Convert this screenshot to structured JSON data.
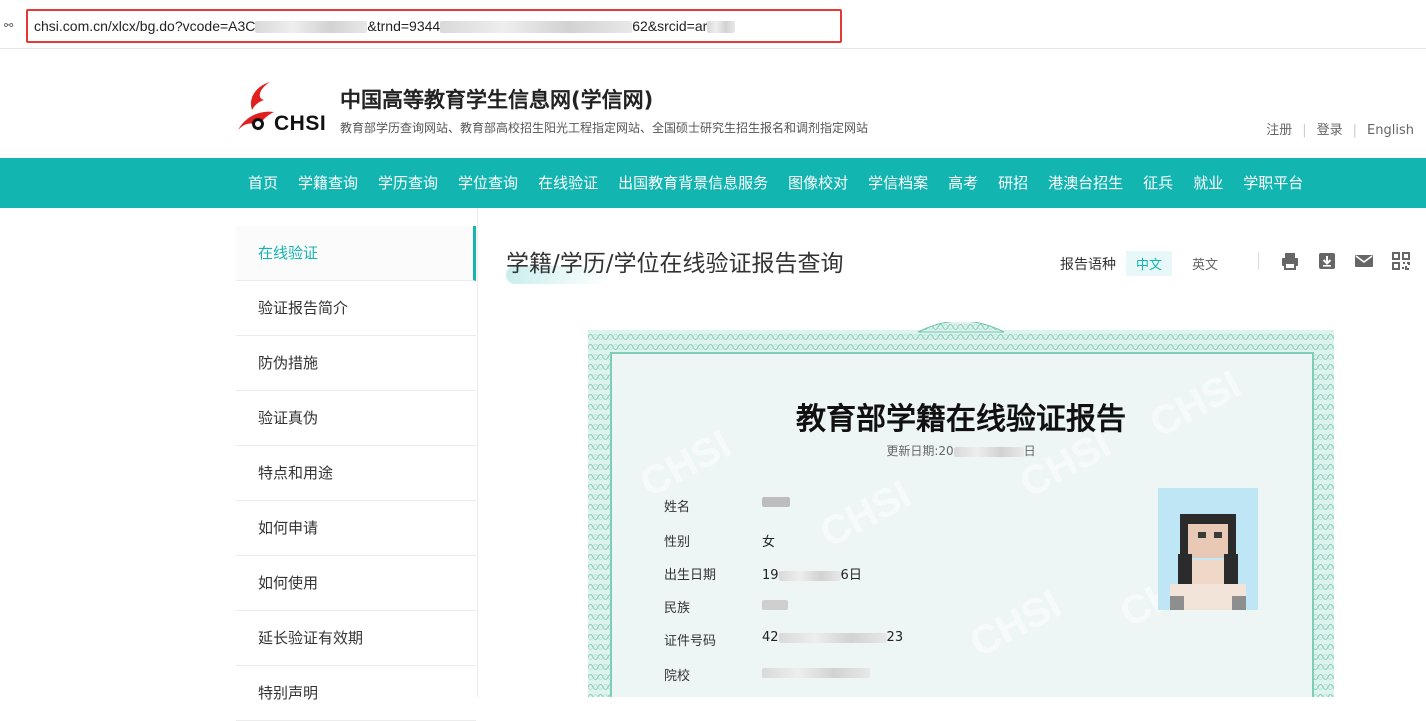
{
  "browser": {
    "url_parts": [
      "chsi.com.cn/xlcx/bg.do?vcode=A3C",
      "&trnd=9344",
      "62&srcid=ar"
    ]
  },
  "header": {
    "logo_text": "CHSI",
    "site_title": "中国高等教育学生信息网(学信网)",
    "site_subtitle": "教育部学历查询网站、教育部高校招生阳光工程指定网站、全国硕士研究生招生报名和调剂指定网站",
    "links": [
      "注册",
      "登录",
      "English"
    ]
  },
  "nav": {
    "items": [
      "首页",
      "学籍查询",
      "学历查询",
      "学位查询",
      "在线验证",
      "出国教育背景信息服务",
      "图像校对",
      "学信档案",
      "高考",
      "研招",
      "港澳台招生",
      "征兵",
      "就业",
      "学职平台"
    ]
  },
  "sidebar": {
    "items": [
      {
        "label": "在线验证",
        "active": true
      },
      {
        "label": "验证报告简介"
      },
      {
        "label": "防伪措施"
      },
      {
        "label": "验证真伪"
      },
      {
        "label": "特点和用途"
      },
      {
        "label": "如何申请"
      },
      {
        "label": "如何使用"
      },
      {
        "label": "延长验证有效期"
      },
      {
        "label": "特别声明"
      }
    ]
  },
  "main": {
    "title": "学籍/学历/学位在线验证报告查询",
    "lang_label": "报告语种",
    "lang_options": [
      "中文",
      "英文"
    ],
    "tool_icons": [
      "print-icon",
      "download-icon",
      "mail-icon",
      "qrcode-icon"
    ]
  },
  "certificate": {
    "title": "教育部学籍在线验证报告",
    "update_label": "更新日期:20",
    "update_suffix": "日",
    "fields": [
      {
        "label": "姓名",
        "value_prefix": "",
        "value_suffix": ""
      },
      {
        "label": "性别",
        "value_prefix": "女",
        "value_suffix": ""
      },
      {
        "label": "出生日期",
        "value_prefix": "19",
        "value_suffix": "6日"
      },
      {
        "label": "民族",
        "value_prefix": "",
        "value_suffix": ""
      },
      {
        "label": "证件号码",
        "value_prefix": "42",
        "value_suffix": "23"
      },
      {
        "label": "院校",
        "value_prefix": "",
        "value_suffix": ""
      }
    ],
    "watermark": "CHSI"
  },
  "colors": {
    "accent": "#13b5b1",
    "url_highlight": "#e53935",
    "certificate_border": "#7dcdb9"
  }
}
